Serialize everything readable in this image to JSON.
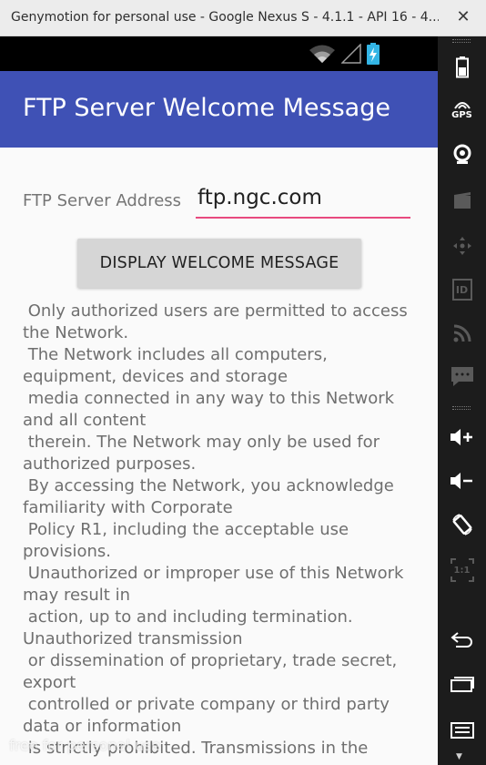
{
  "window": {
    "title": "Genymotion for personal use - Google Nexus S - 4.1.1 - API 16 - 4...",
    "close_icon": "close-icon"
  },
  "statusbar": {
    "icons": [
      "wifi-icon",
      "signal-icon",
      "battery-charging-icon"
    ]
  },
  "appbar": {
    "title": "FTP Server Welcome Message",
    "color": "#3f51b5"
  },
  "form": {
    "address_label": "FTP Server Address",
    "address_value": "ftp.ngc.com",
    "underline_color": "#e84a7f",
    "button_label": "DISPLAY WELCOME MESSAGE"
  },
  "message": {
    "text": " Only authorized users are permitted to access the Network.\n The Network includes all computers, equipment, devices and storage\n media connected in any way to this Network and all content\n therein. The Network may only be used for authorized purposes.\n By accessing the Network, you acknowledge familiarity with Corporate\n Policy R1, including the acceptable use provisions.\n Unauthorized or improper use of this Network may result in\n action, up to and including termination. Unauthorized transmission\n or dissemination of proprietary, trade secret, export\n controlled or private company or third party data or information\n is strictly prohibited. Transmissions in the"
  },
  "sidebar": {
    "items": [
      {
        "name": "battery-icon",
        "label": ""
      },
      {
        "name": "gps-icon",
        "label": "GPS"
      },
      {
        "name": "webcam-icon",
        "label": ""
      },
      {
        "name": "media-icon",
        "label": ""
      },
      {
        "name": "dpad-icon",
        "label": ""
      },
      {
        "name": "id-icon",
        "label": "ID"
      },
      {
        "name": "rss-icon",
        "label": ""
      },
      {
        "name": "sms-icon",
        "label": ""
      },
      {
        "name": "volume-up-icon",
        "label": ""
      },
      {
        "name": "volume-down-icon",
        "label": ""
      },
      {
        "name": "rotate-icon",
        "label": ""
      },
      {
        "name": "scale-icon",
        "label": "1:1"
      },
      {
        "name": "back-icon",
        "label": ""
      },
      {
        "name": "recent-apps-icon",
        "label": ""
      },
      {
        "name": "menu-icon",
        "label": ""
      }
    ]
  },
  "watermark": "free for personal use"
}
